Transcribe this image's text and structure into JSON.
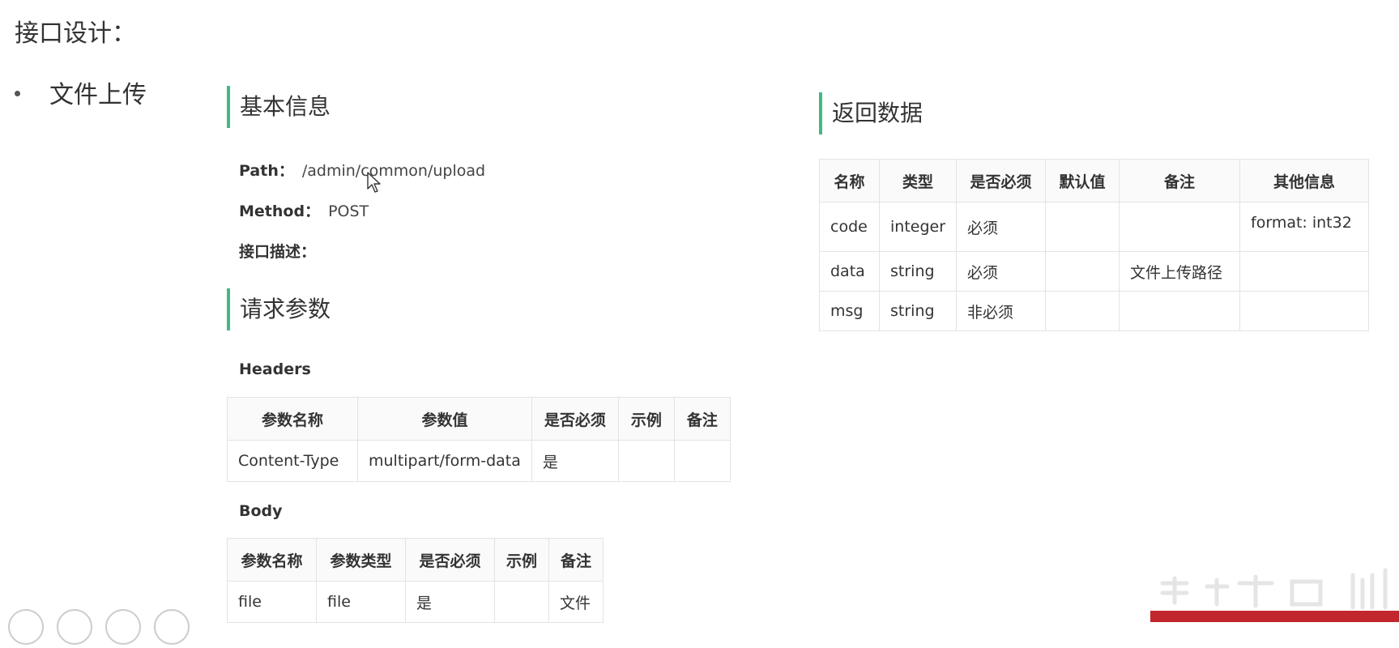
{
  "page": {
    "title": "接口设计：",
    "bullet": "文件上传"
  },
  "basic_info": {
    "heading": "基本信息",
    "path_label": "Path：",
    "path_value": "/admin/common/upload",
    "method_label": "Method：",
    "method_value": "POST",
    "desc_label": "接口描述："
  },
  "request_params": {
    "heading": "请求参数",
    "headers_label": "Headers",
    "headers_table": {
      "columns": [
        "参数名称",
        "参数值",
        "是否必须",
        "示例",
        "备注"
      ],
      "rows": [
        [
          "Content-Type",
          "multipart/form-data",
          "是",
          "",
          ""
        ]
      ]
    },
    "body_label": "Body",
    "body_table": {
      "columns": [
        "参数名称",
        "参数类型",
        "是否必须",
        "示例",
        "备注"
      ],
      "rows": [
        [
          "file",
          "file",
          "是",
          "",
          "文件"
        ]
      ]
    }
  },
  "response": {
    "heading": "返回数据",
    "table": {
      "columns": [
        "名称",
        "类型",
        "是否必须",
        "默认值",
        "备注",
        "其他信息"
      ],
      "rows": [
        [
          "code",
          "integer",
          "必须",
          "",
          "",
          "format: int32"
        ],
        [
          "data",
          "string",
          "必须",
          "",
          "文件上传路径",
          ""
        ],
        [
          "msg",
          "string",
          "非必须",
          "",
          "",
          ""
        ]
      ]
    }
  },
  "colors": {
    "accent": "#42b983",
    "watermark_red": "#c1272d"
  }
}
